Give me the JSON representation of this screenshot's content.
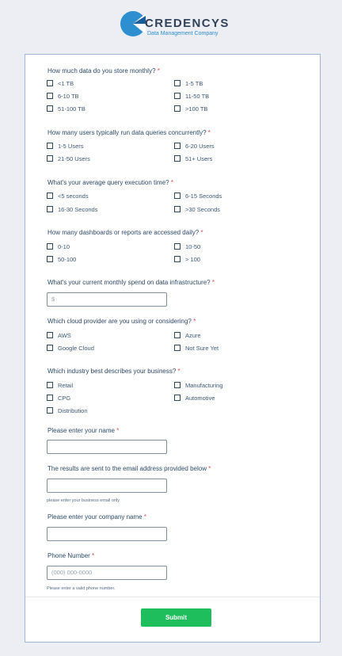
{
  "brand": {
    "name": "CREDENCYS",
    "tagline": "Data Management Company",
    "colors": {
      "primary": "#2e8fd0",
      "dark": "#2f4259"
    }
  },
  "questions": [
    {
      "label": "How much data do you store monthly?",
      "required": "*",
      "options": [
        "<1 TB",
        "1-5 TB",
        "6-10 TB",
        "11-50 TB",
        "51-100 TB",
        ">100 TB"
      ]
    },
    {
      "label": "How many users typically run data queries concurrently?",
      "required": "*",
      "options": [
        "1-5 Users",
        "6-20 Users",
        "21-50 Users",
        "51+ Users"
      ]
    },
    {
      "label": "What's your average query execution time?",
      "required": "*",
      "options": [
        "<5 seconds",
        "6-15 Seconds",
        "16-30 Seconds",
        ">30 Seconds"
      ]
    },
    {
      "label": "How many dashboards or reports are accessed daily?",
      "required": "*",
      "options": [
        "0-10",
        "10-50",
        "50-100",
        "> 100"
      ]
    },
    {
      "label": "What's your current monthly spend on data infrastructure?",
      "required": "*",
      "placeholder": "$"
    },
    {
      "label": "Which cloud provider are you using or considering?",
      "required": "*",
      "options": [
        "AWS",
        "Azure",
        "Google Cloud",
        "Not Sure Yet"
      ]
    },
    {
      "label": "Which industry best describes your business?",
      "required": "*",
      "options": [
        "Retail",
        "Manufacturing",
        "CPG",
        "Automotive",
        "Distribution"
      ]
    },
    {
      "label": "Please enter your name",
      "required": "*",
      "placeholder": ""
    },
    {
      "label": "The results are sent to the email address provided below",
      "required": "*",
      "placeholder": "",
      "hint": "please enter your business email only"
    },
    {
      "label": "Please enter your company name",
      "required": "*",
      "placeholder": ""
    },
    {
      "label": "Phone Number",
      "required": "*",
      "placeholder": "(000) 000-0000",
      "hint": "Please enter a valid phone number."
    }
  ],
  "submit_label": "Submit",
  "accent_color": "#1fbe5c"
}
